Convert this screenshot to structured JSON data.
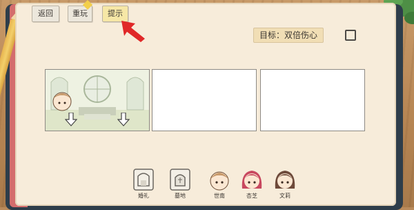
{
  "toolbar": {
    "back_label": "返回",
    "restart_label": "重玩",
    "hint_label": "提示"
  },
  "goal": {
    "label": "目标：双倍伤心",
    "completed": false
  },
  "panels": [
    {
      "content": "church-scene"
    },
    {
      "content": "empty"
    },
    {
      "content": "empty"
    }
  ],
  "items": [
    {
      "name": "婚礼",
      "icon": "wedding-icon"
    },
    {
      "name": "墓地",
      "icon": "grave-icon"
    },
    {
      "name": "世南",
      "icon": "boy-icon"
    },
    {
      "name": "杏芝",
      "icon": "redhead-girl-icon"
    },
    {
      "name": "文莉",
      "icon": "brown-hair-girl-icon"
    }
  ],
  "colors": {
    "page": "#f7ecda",
    "hint_button": "#f6e7a6",
    "arrow_cursor": "#e02828",
    "goal_tag": "#f1deb5"
  }
}
